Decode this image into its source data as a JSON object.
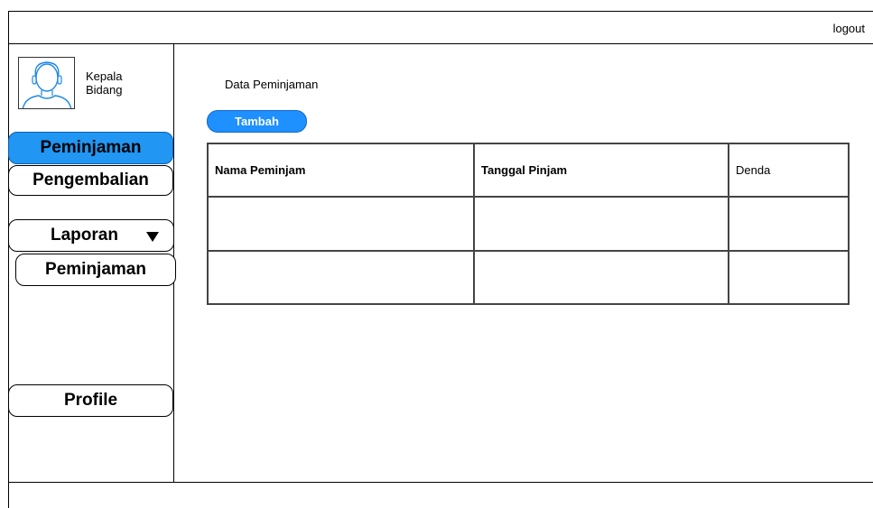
{
  "header": {
    "logout_label": "logout"
  },
  "user": {
    "role_line1": "Kepala",
    "role_line2": "Bidang"
  },
  "sidebar": {
    "items": [
      {
        "label": "Peminjaman"
      },
      {
        "label": "Pengembalian"
      },
      {
        "label": "Laporan"
      },
      {
        "label": "Peminjaman"
      },
      {
        "label": "Profile"
      }
    ]
  },
  "main": {
    "title": "Data Peminjaman",
    "add_button": "Tambah",
    "table": {
      "columns": [
        "Nama Peminjam",
        "Tanggal Pinjam",
        "Denda"
      ],
      "rows": [
        [
          "",
          "",
          ""
        ],
        [
          "",
          "",
          ""
        ]
      ]
    }
  },
  "colors": {
    "accent": "#2196f3",
    "button": "#1e90ff"
  }
}
